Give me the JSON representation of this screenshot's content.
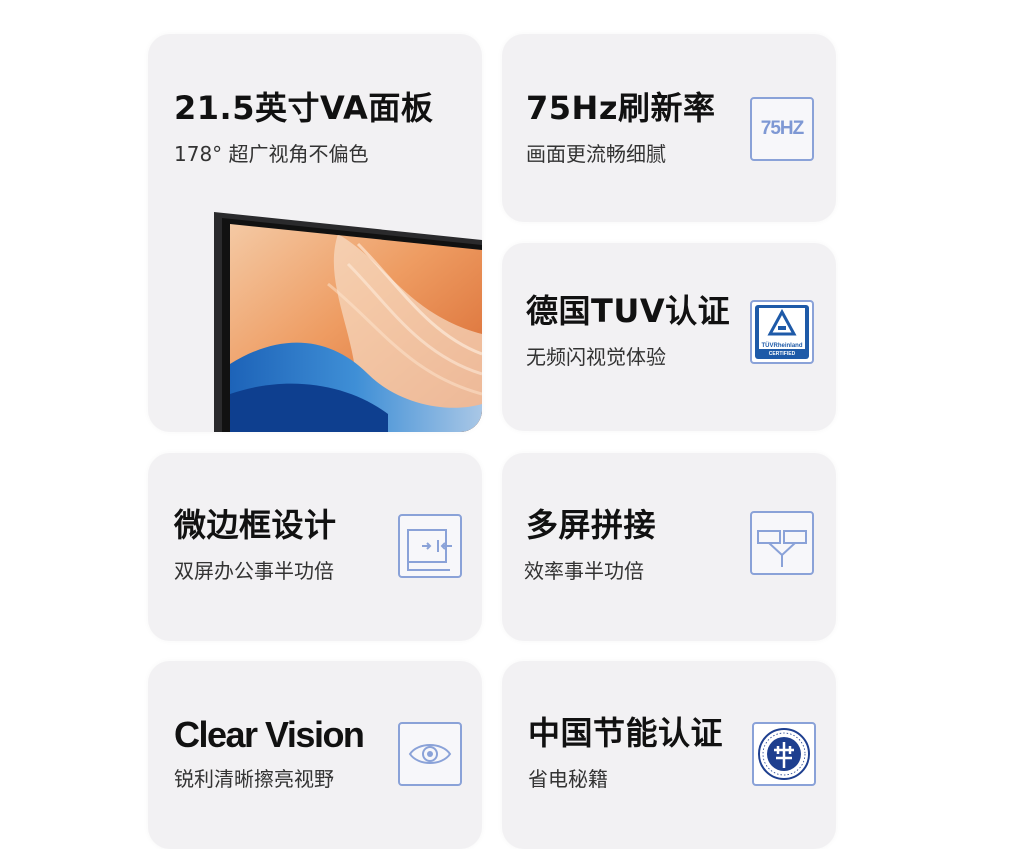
{
  "cards": [
    {
      "title": "21.5英寸VA面板",
      "subtitle": "178° 超广视角不偏色"
    },
    {
      "title": "75Hz刷新率",
      "subtitle": "画面更流畅细腻",
      "icon": "refresh-rate-icon",
      "icon_text": "75HZ"
    },
    {
      "title": "德国TUV认证",
      "subtitle": "无频闪视觉体验",
      "icon": "tuv-certified-logo",
      "logo_text": [
        "TÜVRheinland",
        "CERTIFIED"
      ]
    },
    {
      "title": "微边框设计",
      "subtitle": "双屏办公事半功倍",
      "icon": "narrow-bezel-icon"
    },
    {
      "title": "多屏拼接",
      "subtitle": "效率事半功倍",
      "icon": "multi-screen-icon"
    },
    {
      "title": "Clear Vision",
      "subtitle": "锐利清晰擦亮视野",
      "icon": "eye-icon"
    },
    {
      "title": "中国节能认证",
      "subtitle": "省电秘籍",
      "icon": "energy-saving-cert-logo"
    }
  ],
  "colors": {
    "card_bg": "#f2f1f3",
    "icon_accent": "#8aa2d8",
    "title": "#111111"
  }
}
